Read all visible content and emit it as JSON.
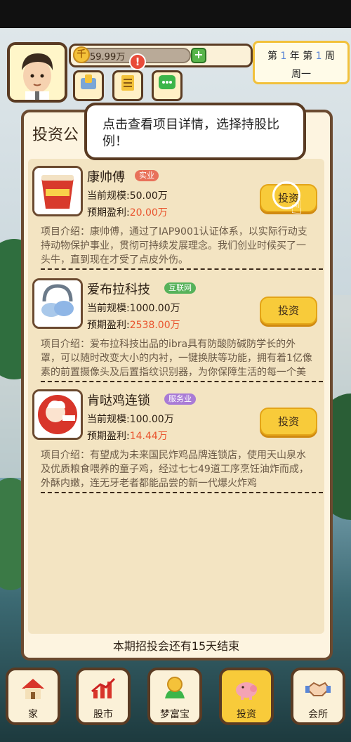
{
  "hud": {
    "coins": "59.99万",
    "coin_symbol": "千",
    "plus": "+",
    "alert": "!",
    "date_line1": {
      "p1": "第",
      "year": "1",
      "p2": "年 第",
      "week": "1",
      "p3": "周"
    },
    "weekday": "周一"
  },
  "panel": {
    "title": "投资公",
    "tooltip": "点击查看项目详情，选择持股比例！",
    "footer": "本期招投会还有15天结束"
  },
  "items": [
    {
      "name": "康帅傅",
      "tag": "实业",
      "tag_color": "#e8715a",
      "scale_label": "当前规模:",
      "scale": "50.00万",
      "profit_label": "预期盈利:",
      "profit": "20.00万",
      "button": "投资",
      "desc": "项目介绍：康帅傅，通过了IAP9001认证体系，以实际行动支持动物保护事业，贯彻可持续发展理念。我们创业时候买了一头牛，直到现在才受了点皮外伤。"
    },
    {
      "name": "爱布拉科技",
      "tag": "互联网",
      "tag_color": "#56b25a",
      "scale_label": "当前规模:",
      "scale": "1000.00万",
      "profit_label": "预期盈利:",
      "profit": "2538.00万",
      "button": "投资",
      "desc": "项目介绍：爱布拉科技出品的ibra具有防酸防碱防学长的外罩，可以随时改变大小的内衬，一键换肤等功能，拥有着1亿像素的前置摄像头及后置指纹识别器，为你保障生活的每一个美好细节"
    },
    {
      "name": "肯哒鸡连锁",
      "tag": "服务业",
      "tag_color": "#a97bd6",
      "scale_label": "当前规模:",
      "scale": "100.00万",
      "profit_label": "预期盈利:",
      "profit": "14.44万",
      "button": "投资",
      "desc": "项目介绍：有望成为未来国民炸鸡品牌连锁店，使用天山泉水及优质粮食喂养的童子鸡，经过七七49道工序烹饪油炸而成，外酥内嫩，连无牙老者都能品尝的新一代爆火炸鸡"
    }
  ],
  "nav": [
    {
      "label": "家",
      "icon": "house-icon"
    },
    {
      "label": "股市",
      "icon": "stock-chart-icon"
    },
    {
      "label": "梦富宝",
      "icon": "coin-plant-icon"
    },
    {
      "label": "投资",
      "icon": "piggy-bank-icon"
    },
    {
      "label": "会所",
      "icon": "handshake-icon"
    }
  ]
}
